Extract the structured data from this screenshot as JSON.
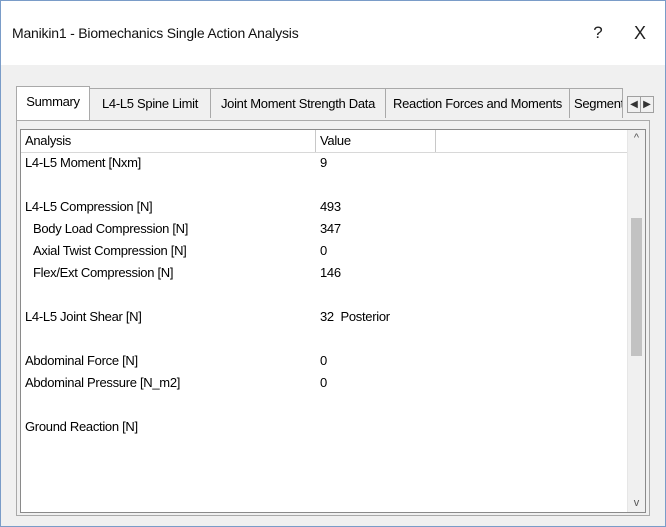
{
  "window": {
    "title": "Manikin1 - Biomechanics Single Action Analysis",
    "help_label": "?",
    "close_label": "X"
  },
  "tabs": [
    {
      "label": "Summary",
      "active": true
    },
    {
      "label": "L4-L5 Spine Limit",
      "active": false
    },
    {
      "label": "Joint Moment Strength Data",
      "active": false
    },
    {
      "label": "Reaction Forces and Moments",
      "active": false
    },
    {
      "label": "Segment I",
      "active": false
    }
  ],
  "tab_scroll": {
    "left": "◀",
    "right": "▶"
  },
  "grid": {
    "columns": [
      "Analysis",
      "Value",
      ""
    ],
    "rows": [
      {
        "analysis": "L4-L5 Moment [Nxm]",
        "value": "9"
      },
      {
        "analysis": "",
        "value": ""
      },
      {
        "analysis": "L4-L5 Compression [N]",
        "value": "493"
      },
      {
        "analysis": "Body Load Compression [N]",
        "value": "347"
      },
      {
        "analysis": "Axial Twist Compression [N]",
        "value": "0"
      },
      {
        "analysis": "Flex/Ext Compression [N]",
        "value": "146"
      },
      {
        "analysis": "",
        "value": ""
      },
      {
        "analysis": "L4-L5 Joint Shear [N]",
        "value": "32  Posterior"
      },
      {
        "analysis": "",
        "value": ""
      },
      {
        "analysis": "Abdominal Force [N]",
        "value": "0"
      },
      {
        "analysis": "Abdominal Pressure [N_m2]",
        "value": "0"
      },
      {
        "analysis": "",
        "value": ""
      },
      {
        "analysis": "Ground Reaction [N]",
        "value": ""
      }
    ],
    "scroll_up": "^",
    "scroll_down": "v"
  }
}
